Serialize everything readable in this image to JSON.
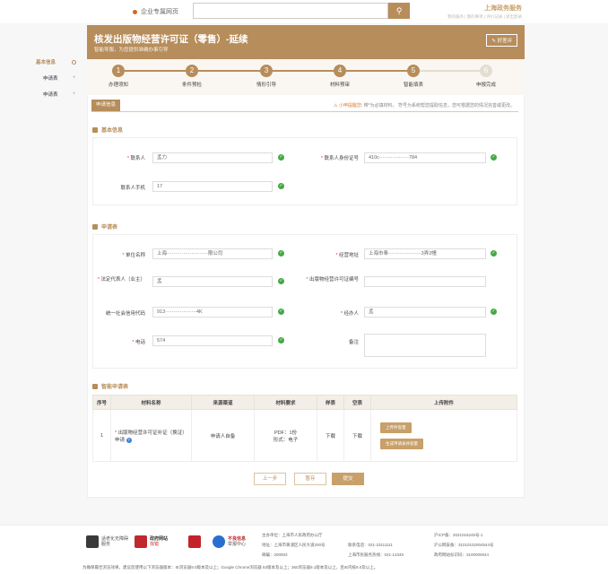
{
  "topbar": {
    "brand": "企业专属网页",
    "search_placeholder": "",
    "right_title": "上海政务服务",
    "right_links": "我的服务 | 我的事项 | 评价记录 | 退出登录"
  },
  "sidebar": {
    "items": [
      {
        "label": "基本信息"
      },
      {
        "label": "申请表"
      },
      {
        "label": "申请表"
      }
    ]
  },
  "header": {
    "title": "核发出版物经营许可证（零售）-延续",
    "subtitle": "智能导服，为您提供准确办事引导",
    "eval_button": "好差评"
  },
  "steps": [
    {
      "num": "1",
      "label": "办理须知",
      "done": true
    },
    {
      "num": "2",
      "label": "条件预检",
      "done": true
    },
    {
      "num": "3",
      "label": "情形引导",
      "done": true
    },
    {
      "num": "4",
      "label": "材料预审",
      "done": true
    },
    {
      "num": "5",
      "label": "智能填表",
      "done": true
    },
    {
      "num": "6",
      "label": "申报完成",
      "done": false
    }
  ],
  "tab": {
    "label": "申请信息",
    "tip_warn": "小申提醒您:",
    "tip_text": "带*为必填材料。 符号为系统帮您提取信息，您可根据您的情况完善或更改。"
  },
  "basic": {
    "title": "基本信息",
    "contact_label": "联系人",
    "contact_value": "孟力",
    "id_label": "联系人身份证号",
    "id_value": "410c··················784",
    "phone_label": "联系人手机",
    "phone_value": "17"
  },
  "form": {
    "title": "申请表",
    "unit_label": "单位名称",
    "unit_value": "上海·························限公司",
    "addr_label": "经营地址",
    "addr_value": "上海市奉····················3弄2幢",
    "legal_label": "法定代表人（业主）",
    "legal_value": "孟",
    "license_label": "出版物经营许可证编号",
    "license_value": "",
    "credit_label": "统一社会信用代码",
    "credit_value": "913···················4K",
    "handler_label": "经办人",
    "handler_value": "孟",
    "tel_label": "电话",
    "tel_value": "574",
    "remark_label": "备注",
    "remark_value": ""
  },
  "materials": {
    "title": "智能申请表",
    "headers": [
      "序号",
      "材料名称",
      "来源渠道",
      "材料要求",
      "样表",
      "空表",
      "上传附件"
    ],
    "rows": [
      {
        "no": "1",
        "name": "出版物经营许可证补证（换证）申请",
        "source": "申请人自备",
        "req1": "PDF：1份",
        "req2": "形式：电子",
        "sample": "下载",
        "blank": "下载",
        "upload_btn": "上传件容量",
        "gen_btn": "生成申请表并容量"
      }
    ]
  },
  "buttons": {
    "prev": "上一步",
    "save": "暂存",
    "submit": "提交"
  },
  "footer": {
    "logo1": "适老化无障碍服务",
    "logo2_a": "政府网站",
    "logo2_b": "找错",
    "logo4_a": "不良信息",
    "logo4_b": "举报中心",
    "host": "主办单位：上海市人民政府办公厅",
    "address": "地址：上海市黄浦区人民大道200号",
    "postcode": "邮编：200003",
    "phone": "联系电话：021-23111111",
    "phone2": "上海市民服务热线：021-12345",
    "icp": "沪ICP备：2021016245号-1",
    "police": "沪公网安备：31010102004544号",
    "site_code": "政府网站标识码：3100000044",
    "compat": "为确保最佳浏览效果，建议您使用以下浏览器版本：IE浏览器9.0版本及以上；Google Chrome浏览器 63版本及以上；360浏览器9.1版本及以上，且IE内核9.0及以上。"
  }
}
